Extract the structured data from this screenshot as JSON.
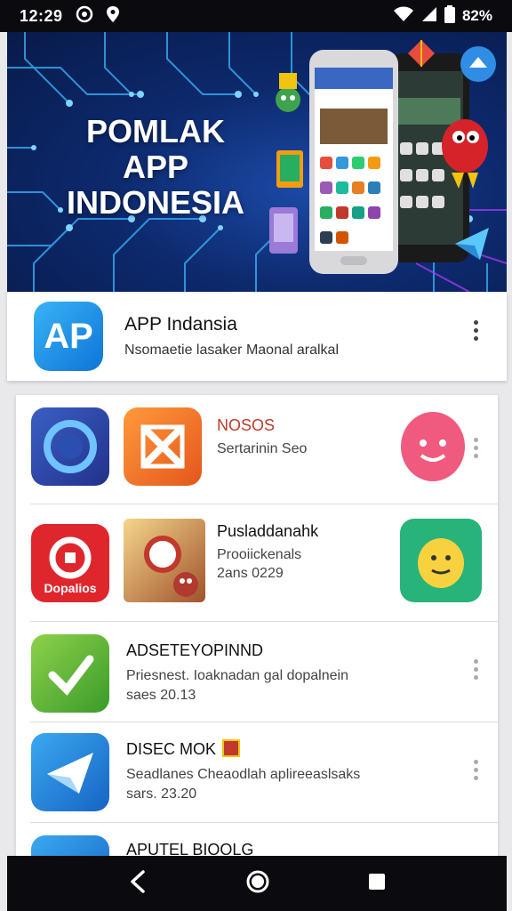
{
  "status_bar": {
    "time": "12:29",
    "battery_text": "82%",
    "icons": [
      "whatsapp-icon",
      "location-icon",
      "wifi-icon",
      "signal-icon",
      "battery-icon"
    ]
  },
  "hero": {
    "title_line1": "POMLAK",
    "title_line2": "APP INDONESIA",
    "colors": {
      "background": "#0d2a6e",
      "circuit": "#3ab7ff"
    }
  },
  "app_header": {
    "logo_text": "AP",
    "name": "APP Indansia",
    "description": "Nsomaetie lasaker Maonal aralkal"
  },
  "list": [
    {
      "title": "NOSOS",
      "subtitle_lines": [
        "Sertarinin Seo"
      ],
      "title_color": "#c0392b",
      "icons": [
        "globe-circle-icon",
        "scissors-app-icon",
        "smiley-face-icon"
      ]
    },
    {
      "title": "Pusladdanahk",
      "subtitle_lines": [
        "Prooiickenals",
        "2ans 0229"
      ],
      "title_color": "#111111",
      "badge_text": "Dopalios",
      "icons": [
        "red-app-icon",
        "game-character-icon",
        "yellow-character-icon"
      ]
    },
    {
      "title": "ADSETEYOPINND",
      "subtitle_lines": [
        "Priesnest. Ioaknadan gal dopalnein",
        "saes 20.13"
      ],
      "title_color": "#111111",
      "icons": [
        "green-check-icon"
      ]
    },
    {
      "title": "DISEC MOK",
      "subtitle_lines": [
        "Seadlanes Cheaodlah aplireeaslsaks",
        "sars. 23.20"
      ],
      "title_color": "#111111",
      "icons": [
        "blue-plane-icon"
      ]
    },
    {
      "title": "APUTEL BIOOLG",
      "subtitle_lines": [],
      "title_color": "#111111",
      "icons": [
        "blue-app-icon"
      ]
    }
  ],
  "nav_bar": {
    "buttons": [
      "back-icon",
      "home-icon",
      "recents-icon"
    ]
  }
}
